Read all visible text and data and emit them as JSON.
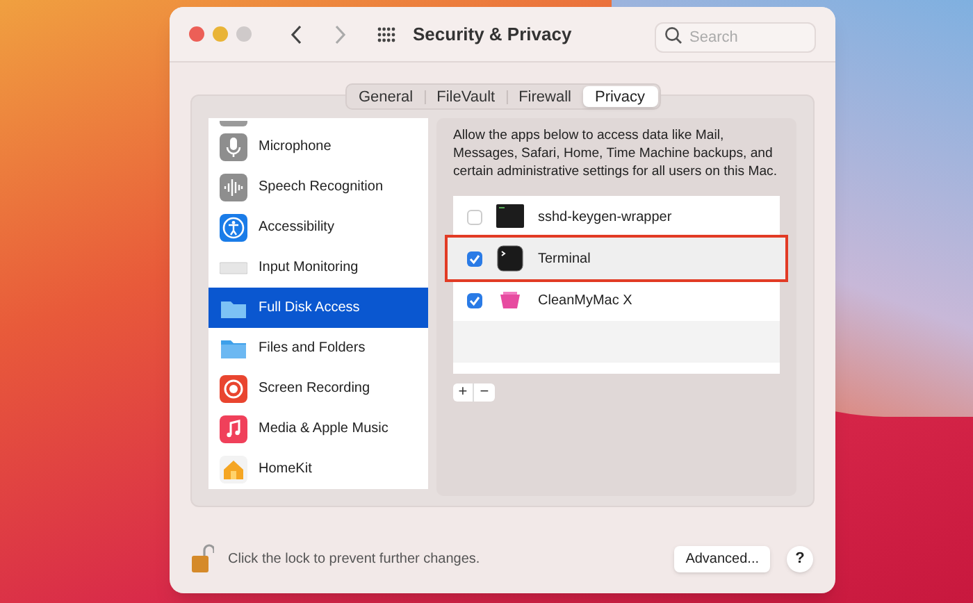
{
  "window": {
    "title": "Security & Privacy"
  },
  "search": {
    "placeholder": "Search"
  },
  "tabs": [
    {
      "label": "General",
      "selected": false
    },
    {
      "label": "FileVault",
      "selected": false
    },
    {
      "label": "Firewall",
      "selected": false
    },
    {
      "label": "Privacy",
      "selected": true
    }
  ],
  "sidebar": {
    "items": [
      {
        "label": "Microphone",
        "selected": false
      },
      {
        "label": "Speech Recognition",
        "selected": false
      },
      {
        "label": "Accessibility",
        "selected": false
      },
      {
        "label": "Input Monitoring",
        "selected": false
      },
      {
        "label": "Full Disk Access",
        "selected": true
      },
      {
        "label": "Files and Folders",
        "selected": false
      },
      {
        "label": "Screen Recording",
        "selected": false
      },
      {
        "label": "Media & Apple Music",
        "selected": false
      },
      {
        "label": "HomeKit",
        "selected": false
      }
    ]
  },
  "description": "Allow the apps below to access data like Mail, Messages, Safari, Home, Time Machine backups, and certain administrative settings for all users on this Mac.",
  "apps": [
    {
      "name": "sshd-keygen-wrapper",
      "checked": false,
      "selected": false,
      "highlighted": false
    },
    {
      "name": "Terminal",
      "checked": true,
      "selected": true,
      "highlighted": true
    },
    {
      "name": "CleanMyMac X",
      "checked": true,
      "selected": false,
      "highlighted": false
    }
  ],
  "list_buttons": [
    "+",
    "−"
  ],
  "footer": {
    "lock_text": "Click the lock to prevent further changes.",
    "advanced_button": "Advanced...",
    "help_button": "?"
  }
}
